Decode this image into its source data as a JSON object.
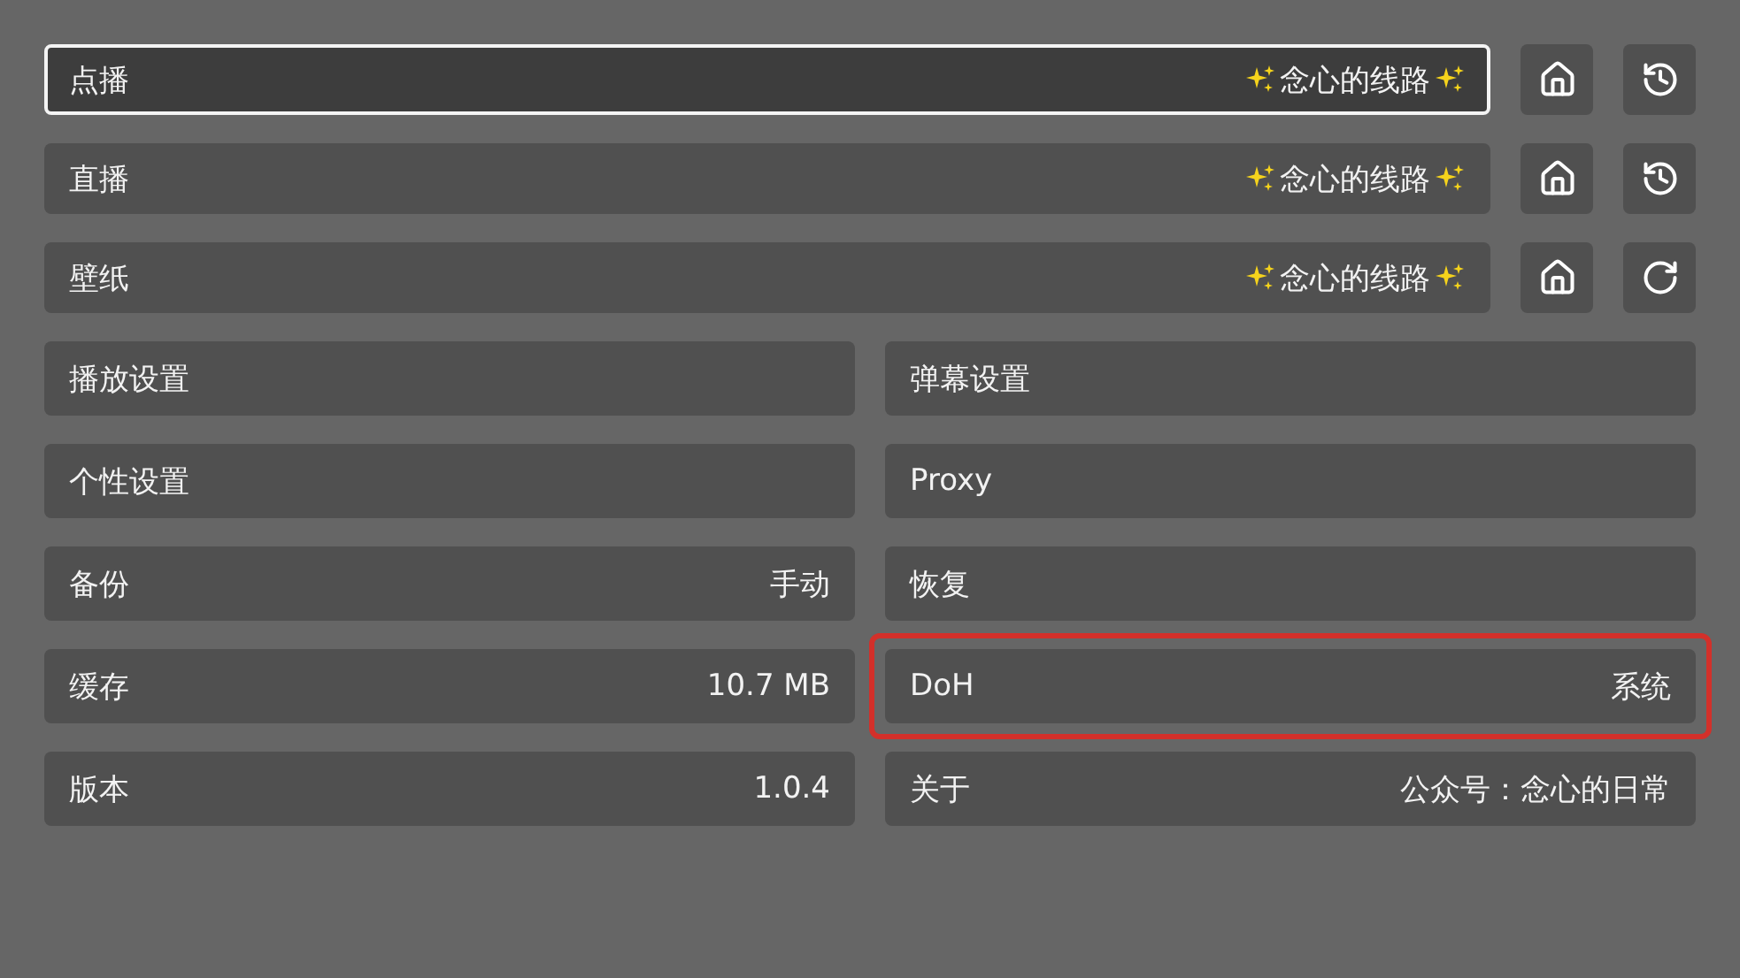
{
  "sources": [
    {
      "label": "点播",
      "value": "念心的线路",
      "focused": true,
      "actions": [
        {
          "kind": "home"
        },
        {
          "kind": "history"
        }
      ]
    },
    {
      "label": "直播",
      "value": "念心的线路",
      "focused": false,
      "actions": [
        {
          "kind": "home"
        },
        {
          "kind": "history"
        }
      ]
    },
    {
      "label": "壁纸",
      "value": "念心的线路",
      "focused": false,
      "actions": [
        {
          "kind": "home"
        },
        {
          "kind": "refresh"
        }
      ]
    }
  ],
  "settings": [
    {
      "label": "播放设置",
      "highlighted": false
    },
    {
      "label": "弹幕设置",
      "highlighted": false
    },
    {
      "label": "个性设置",
      "highlighted": false
    },
    {
      "label": "Proxy",
      "highlighted": false
    },
    {
      "label": "备份",
      "value": "手动",
      "highlighted": false
    },
    {
      "label": "恢复",
      "highlighted": false
    },
    {
      "label": "缓存",
      "value": "10.7 MB",
      "highlighted": false
    },
    {
      "label": "DoH",
      "value": "系统",
      "highlighted": true
    },
    {
      "label": "版本",
      "value": "1.0.4",
      "highlighted": false
    },
    {
      "label": "关于",
      "value": "公众号：念心的日常",
      "highlighted": false
    }
  ]
}
